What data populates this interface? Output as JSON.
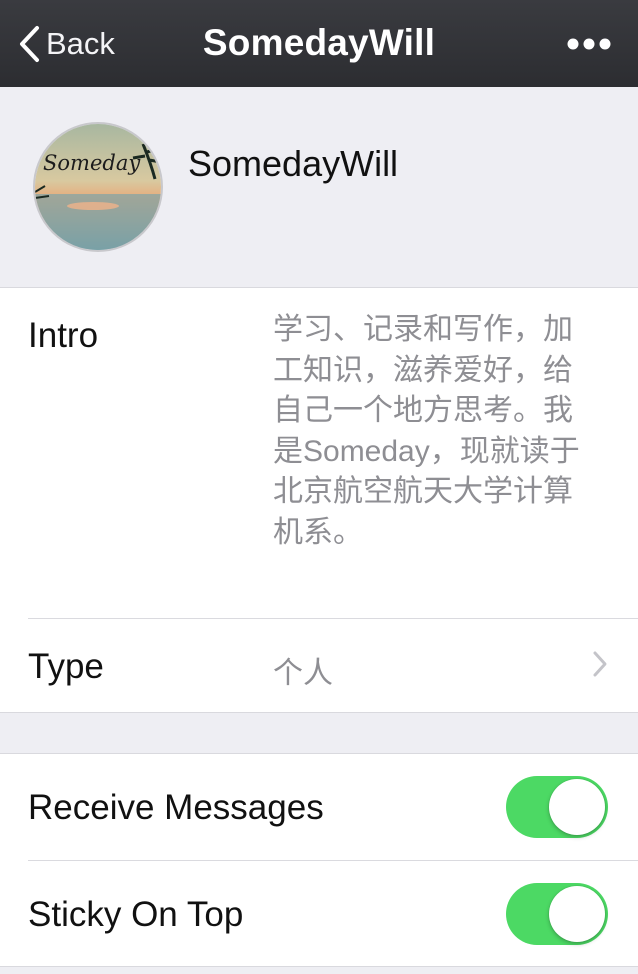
{
  "navbar": {
    "back_label": "Back",
    "title": "SomedayWill",
    "more_icon": "more-icon"
  },
  "profile": {
    "avatar_text": "Someday",
    "name": "SomedayWill"
  },
  "info": {
    "intro_label": "Intro",
    "intro_text": "学习、记录和写作，加工知识，滋养爱好，给自己一个地方思考。我是Someday，现就读于北京航空航天大学计算机系。",
    "type_label": "Type",
    "type_value": "个人"
  },
  "settings": {
    "receive_label": "Receive Messages",
    "receive_on": true,
    "sticky_label": "Sticky On Top",
    "sticky_on": true
  },
  "colors": {
    "navbar": "#2f3034",
    "background": "#eeeef3",
    "toggle_on": "#4cd964",
    "secondary_text": "#8e8e93"
  }
}
